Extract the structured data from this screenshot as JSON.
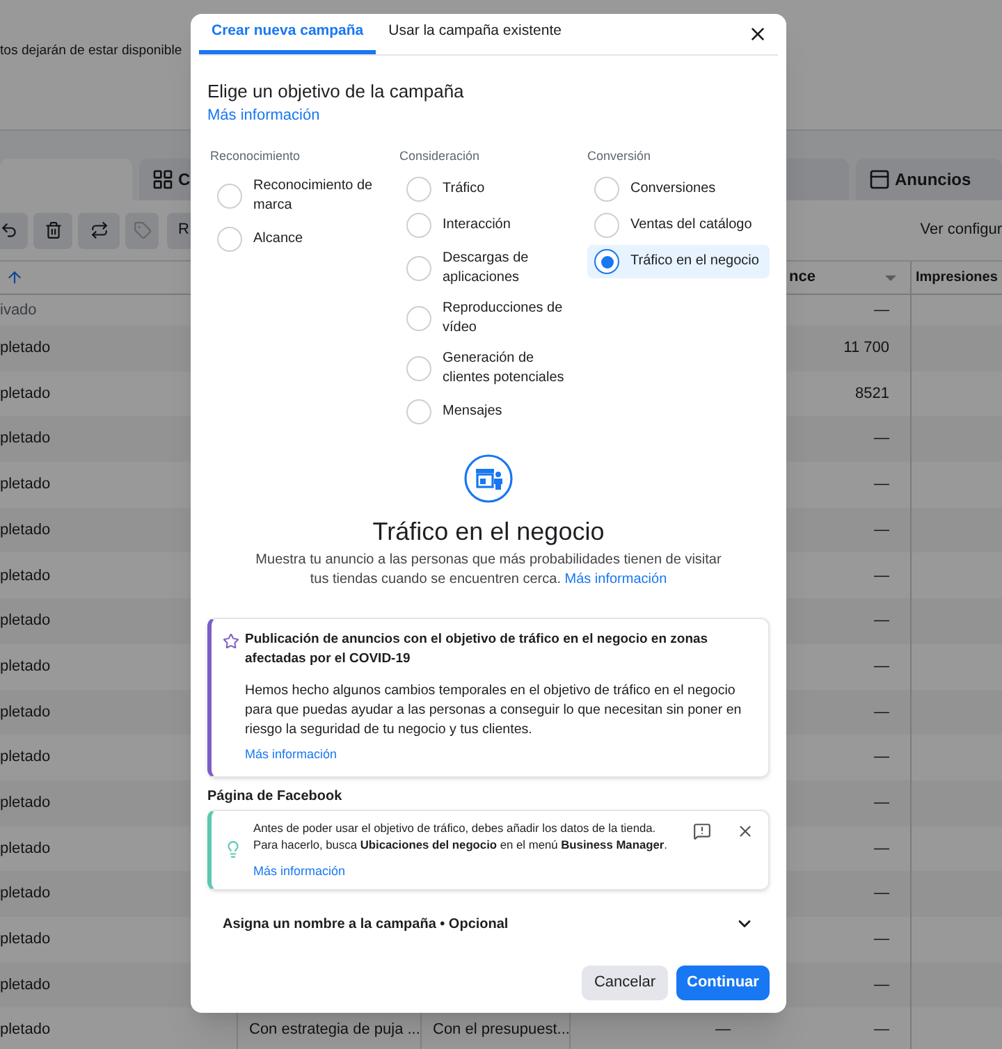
{
  "background": {
    "notice": "tos dejarán de estar disponible",
    "tabs": [
      {
        "label": "C",
        "selected": false
      },
      {
        "label": "Anuncios",
        "selected": false
      }
    ],
    "toolbar": {
      "button": "R",
      "link": "Ver configur"
    },
    "columns": [
      "nce",
      "Impresiones"
    ],
    "rows": [
      {
        "status": "ivado",
        "value": "—"
      },
      {
        "status": "pletado",
        "value": "11 700"
      },
      {
        "status": "pletado",
        "value": "8521"
      },
      {
        "status": "pletado",
        "value": "—"
      },
      {
        "status": "pletado",
        "value": "—"
      },
      {
        "status": "pletado",
        "value": "—"
      },
      {
        "status": "pletado",
        "value": "—"
      },
      {
        "status": "pletado",
        "value": "—"
      },
      {
        "status": "pletado",
        "value": "—"
      },
      {
        "status": "pletado",
        "value": "—"
      },
      {
        "status": "pletado",
        "value": "—"
      },
      {
        "status": "pletado",
        "value": "—"
      },
      {
        "status": "pletado",
        "value": "—"
      },
      {
        "status": "pletado",
        "value": "—"
      },
      {
        "status": "pletado",
        "value": "—"
      },
      {
        "status": "pletado",
        "value": "—"
      },
      {
        "status": "pletado",
        "bid": "Con estrategia de puja ...",
        "budget": "Con el presupuest...",
        "col_4": "—",
        "value": "—"
      }
    ]
  },
  "modal": {
    "tabs": [
      {
        "label": "Crear nueva campaña",
        "selected": true
      },
      {
        "label": "Usar la campaña existente",
        "selected": false
      }
    ],
    "title": "Elige un objetivo de la campaña",
    "link": "Más información",
    "columns": [
      {
        "heading": "Reconocimiento",
        "options": [
          {
            "label": "Reconocimiento de marca",
            "selected": false
          },
          {
            "label": "Alcance",
            "selected": false
          }
        ]
      },
      {
        "heading": "Consideración",
        "options": [
          {
            "label": "Tráfico",
            "selected": false
          },
          {
            "label": "Interacción",
            "selected": false
          },
          {
            "label": "Descargas de aplicaciones",
            "selected": false
          },
          {
            "label": "Reproducciones de vídeo",
            "selected": false
          },
          {
            "label": "Generación de clientes potenciales",
            "selected": false
          },
          {
            "label": "Mensajes",
            "selected": false
          }
        ]
      },
      {
        "heading": "Conversión",
        "options": [
          {
            "label": "Conversiones",
            "selected": false
          },
          {
            "label": "Ventas del catálogo",
            "selected": false
          },
          {
            "label": "Tráfico en el negocio",
            "selected": true
          }
        ]
      }
    ],
    "objective": {
      "title": "Tráfico en el negocio",
      "description": "Muestra tu anuncio a las personas que más probabilidades tienen de visitar tus tiendas cuando se encuentren cerca.",
      "link": "Más información"
    },
    "notice": {
      "title": "Publicación de anuncios con el objetivo de tráfico en el negocio en zonas afectadas por el COVID-19",
      "body": "Hemos hecho algunos cambios temporales en el objetivo de tráfico en el negocio para que puedas ayudar a las personas a conseguir lo que necesitan sin poner en riesgo la seguridad de tu negocio y tus clientes.",
      "link": "Más información"
    },
    "page_section": {
      "label": "Página de Facebook",
      "tip": "Antes de poder usar el objetivo de tráfico, debes añadir los datos de la tienda. Para hacerlo, busca **Ubicaciones del negocio** en el menú **Business Manager**.",
      "link": "Más información"
    },
    "name_section": {
      "label": "Asigna un nombre a la campaña • Opcional",
      "expanded": false
    },
    "buttons": [
      {
        "label": "Cancelar",
        "kind": "secondary"
      },
      {
        "label": "Continuar",
        "kind": "primary"
      }
    ]
  }
}
